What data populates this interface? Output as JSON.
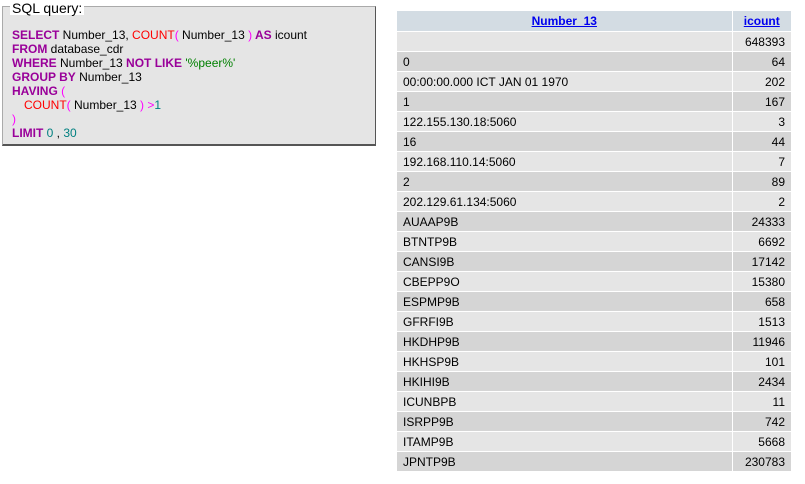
{
  "sql": {
    "legend": "SQL query:",
    "line1": {
      "kw1": "SELECT",
      "col": " Number_13, ",
      "fn": "COUNT",
      "p1": "(",
      "arg": " Number_13 ",
      "p2": ")",
      "kw2": " AS",
      "alias": " icount"
    },
    "line2": {
      "kw": "FROM",
      "text": " database_cdr"
    },
    "line3": {
      "kw1": "WHERE",
      "col": " Number_13 ",
      "kw2": "NOT LIKE",
      "str": " '%peer%'"
    },
    "line4": {
      "kw": "GROUP BY",
      "text": " Number_13"
    },
    "line5": {
      "kw": "HAVING",
      "p": " ("
    },
    "line6": {
      "fn": "COUNT",
      "p1": "(",
      "arg": " Number_13 ",
      "p2": ")",
      "op": " >",
      "num": "1"
    },
    "line7": {
      "p": ")"
    },
    "line8": {
      "kw": "LIMIT",
      "n1": " 0",
      "sep": " , ",
      "n2": "30"
    }
  },
  "table": {
    "headers": [
      "Number_13",
      "icount"
    ],
    "rows": [
      [
        "",
        "648393"
      ],
      [
        "0",
        "64"
      ],
      [
        "00:00:00.000 ICT JAN 01 1970",
        "202"
      ],
      [
        "1",
        "167"
      ],
      [
        "122.155.130.18:5060",
        "3"
      ],
      [
        "16",
        "44"
      ],
      [
        "192.168.110.14:5060",
        "7"
      ],
      [
        "2",
        "89"
      ],
      [
        "202.129.61.134:5060",
        "2"
      ],
      [
        "AUAAP9B",
        "24333"
      ],
      [
        "BTNTP9B",
        "6692"
      ],
      [
        "CANSI9B",
        "17142"
      ],
      [
        "CBEPP9O",
        "15380"
      ],
      [
        "ESPMP9B",
        "658"
      ],
      [
        "GFRFI9B",
        "1513"
      ],
      [
        "HKDHP9B",
        "11946"
      ],
      [
        "HKHSP9B",
        "101"
      ],
      [
        "HKIHI9B",
        "2434"
      ],
      [
        "ICUNBPB",
        "11"
      ],
      [
        "ISRPP9B",
        "742"
      ],
      [
        "ITAMP9B",
        "5668"
      ],
      [
        "JPNTP9B",
        "230783"
      ]
    ]
  }
}
